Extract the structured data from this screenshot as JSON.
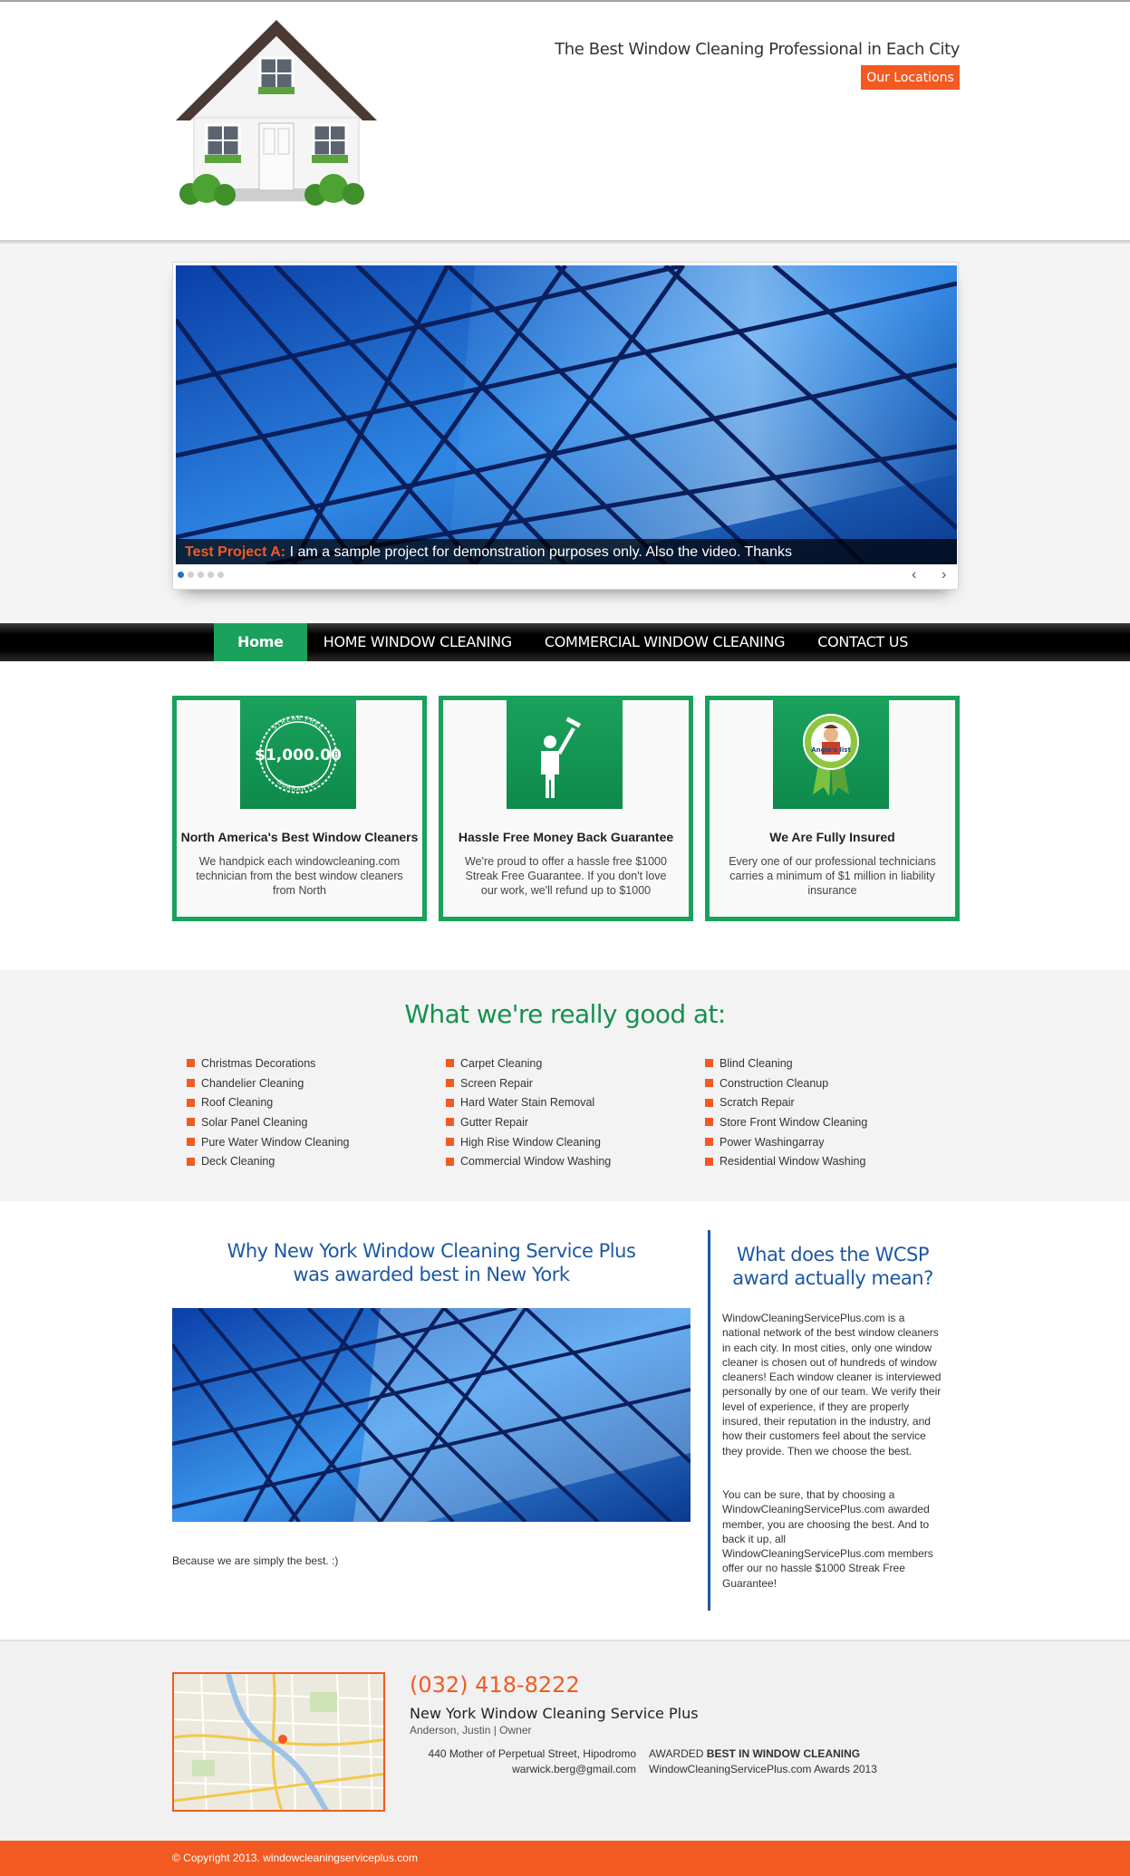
{
  "header": {
    "tagline": "The Best Window Cleaning Professional in Each City",
    "locations_button": "Our Locations"
  },
  "slider": {
    "caption_title": "Test Project A:",
    "caption_text": "I am a sample project for demonstration purposes only. Also the video. Thanks",
    "slide_count": 5,
    "active_slide": 1,
    "prev_label": "‹",
    "next_label": "›"
  },
  "nav": {
    "items": [
      "Home",
      "HOME WINDOW CLEANING",
      "COMMERCIAL WINDOW CLEANING",
      "CONTACT US"
    ],
    "active": "Home"
  },
  "features": [
    {
      "title": "North America's Best Window Cleaners",
      "text": "We handpick each windowcleaning.com technician from the best window cleaners from North",
      "badge": "$1,000.00",
      "badge_arc_top": "STREAK FREE",
      "badge_arc_bottom": "GUARANTEE"
    },
    {
      "title": "Hassle Free Money Back Guarantee",
      "text": "We're proud to offer a hassle free $1000 Streak Free Guarantee. If you don't love our work, we'll refund up to $1000",
      "icon": "window-cleaner-icon"
    },
    {
      "title": "We Are Fully Insured",
      "text": "Every one of our professional technicians carries a minimum of $1 million in liability insurance",
      "badge": "Angie's list"
    }
  ],
  "services": {
    "title": "What we're really good at:",
    "columns": [
      [
        "Christmas Decorations",
        "Chandelier Cleaning",
        "Roof Cleaning",
        "Solar Panel Cleaning",
        "Pure Water Window Cleaning",
        "Deck Cleaning"
      ],
      [
        "Carpet Cleaning",
        "Screen Repair",
        "Hard Water Stain Removal",
        "Gutter Repair",
        "High Rise Window Cleaning",
        "Commercial Window Washing"
      ],
      [
        "Blind Cleaning",
        "Construction Cleanup",
        "Scratch Repair",
        "Store Front Window Cleaning",
        "Power Washingarray",
        "Residential Window Washing"
      ]
    ]
  },
  "why": {
    "title_line1": "Why New York Window Cleaning Service Plus",
    "title_line2": "was awarded best in New York",
    "note": "Because we are simply the best. :)"
  },
  "wcsp": {
    "title_line1": "What does the WCSP",
    "title_line2": "award actually mean?",
    "paragraph1": "WindowCleaningServicePlus.com is a national network of the best window cleaners in each city. In most cities, only one window cleaner is chosen out of hundreds of window cleaners! Each window cleaner is interviewed personally by one of our team. We verify their level of experience, if they are properly insured, their reputation in the industry, and how their customers feel about the service they provide. Then we choose the best.",
    "paragraph2": "You can be sure, that by choosing a WindowCleaningServicePlus.com awarded member, you are choosing the best. And to back it up, all WindowCleaningServicePlus.com members offer our no hassle $1000 Streak Free Guarantee!"
  },
  "footer": {
    "phone": "(032) 418-8222",
    "business_name": "New York Window Cleaning Service Plus",
    "owner": "Anderson, Justin | Owner",
    "address": "440 Mother of Perpetual Street, Hipodromo",
    "email": "warwick.berg@gmail.com",
    "award_prefix": "AWARDED ",
    "award_bold": "BEST IN WINDOW CLEANING",
    "award_line2": "WindowCleaningServicePlus.com Awards 2013",
    "copyright": "© Copyright 2013. windowcleaningserviceplus.com"
  },
  "colors": {
    "accent_orange": "#f25a22",
    "accent_green": "#1aa15c",
    "heading_blue": "#1d58a4",
    "nav_black": "#000000"
  }
}
